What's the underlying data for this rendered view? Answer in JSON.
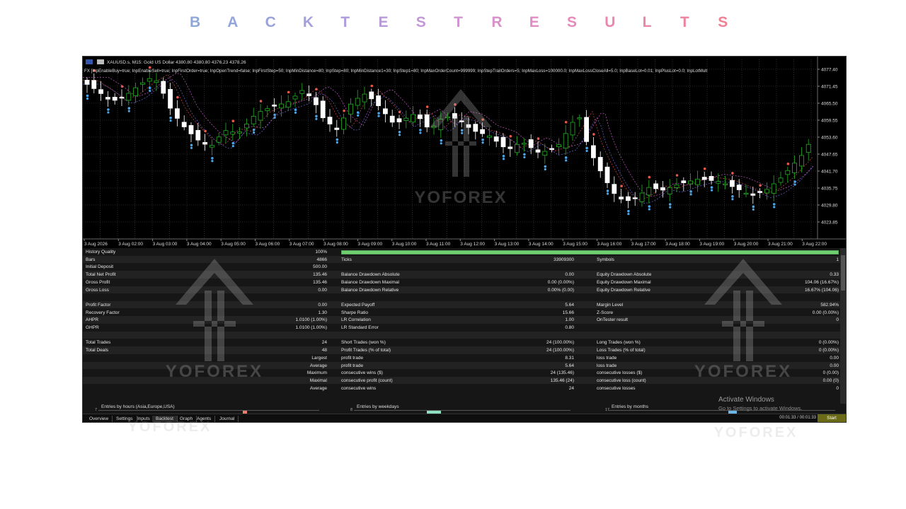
{
  "heading": {
    "letters": [
      "B",
      "A",
      "C",
      "K",
      "T",
      "E",
      "S",
      "T",
      "R",
      "E",
      "S",
      "U",
      "L",
      "T",
      "S"
    ],
    "colors": [
      "#8fa8d8",
      "#93a6da",
      "#9aa2dc",
      "#a39fdc",
      "#ad9cdb",
      "#b89ad9",
      "#c497d6",
      "#cf94d2",
      "#d991cc",
      "#e08dc4",
      "#e68abb",
      "#ea87b1",
      "#ed85a7",
      "#ef839d",
      "#f08194"
    ]
  },
  "chart": {
    "header": {
      "symbol": "XAUUSD.s, M15:  Gold US Dollar  4380.80 4380.80 4376.23 4378.26",
      "params": "FX [InpEnableBuy=true; InpEnableSell=true; InpFirstOrder=true; InpOpenTrend=false; InpFirstStep=50; InpMinDistance=80; InpStep=80; InpMinDistance1=30; InpStep1=80; InpMaxOrderCount=999999; InpStepTrailOrders=5; InpMaxLoss=100000.0; InpMaxLossCloseAll=5.0; InpBaseLot=0.01; InpPlusLot=0.0; InpLotMult"
    },
    "price_labels": [
      "4077.40",
      "4071.45",
      "4065.50",
      "4059.55",
      "4053.60",
      "4047.65",
      "4041.70",
      "4035.75",
      "4029.80",
      "4023.85"
    ],
    "time_labels": [
      "3 Aug 2026",
      "3 Aug 02:00",
      "3 Aug 03:00",
      "3 Aug 04:00",
      "3 Aug 05:00",
      "3 Aug 06:00",
      "3 Aug 07:00",
      "3 Aug 08:00",
      "3 Aug 09:00",
      "3 Aug 10:00",
      "3 Aug 11:00",
      "3 Aug 12:00",
      "3 Aug 13:00",
      "3 Aug 14:00",
      "3 Aug 15:00",
      "3 Aug 16:00",
      "3 Aug 17:00",
      "3 Aug 18:00",
      "3 Aug 19:00",
      "3 Aug 20:00",
      "3 Aug 21:00",
      "3 Aug 22:00"
    ],
    "watermark": "YOFOREX",
    "colors": {
      "bull": "#22b022",
      "bear": "#ffffff",
      "grid": "#4a4a4a",
      "buy_marker": "#4aa6e8",
      "sell_marker": "#e8584a"
    }
  },
  "report": {
    "quality": {
      "label": "History Quality",
      "value": "100%",
      "fraction": 1.0
    },
    "rows": [
      {
        "c1": [
          "Bars",
          "4866"
        ],
        "c2": [
          "Ticks",
          "33909300"
        ],
        "c3": [
          "Symbols",
          "1"
        ]
      },
      {
        "c1": [
          "Initial Deposit",
          "500.00"
        ],
        "c2": [
          "",
          ""
        ],
        "c3": [
          "",
          ""
        ]
      },
      {
        "c1": [
          "Total Net Profit",
          "135.46"
        ],
        "c2": [
          "Balance Drawdown Absolute",
          "0.00"
        ],
        "c3": [
          "Equity Drawdown Absolute",
          "0.33"
        ]
      },
      {
        "c1": [
          "Gross Profit",
          "135.46"
        ],
        "c2": [
          "Balance Drawdown Maximal",
          "0.00 (0.00%)"
        ],
        "c3": [
          "Equity Drawdown Maximal",
          "104.06 (16.67%)"
        ]
      },
      {
        "c1": [
          "Gross Loss",
          "0.00"
        ],
        "c2": [
          "Balance Drawdown Relative",
          "0.00% (0.00)"
        ],
        "c3": [
          "Equity Drawdown Relative",
          "16.67% (104.06)"
        ]
      },
      {
        "c1": [
          "",
          ""
        ],
        "c2": [
          "",
          ""
        ],
        "c3": [
          "",
          ""
        ]
      },
      {
        "c1": [
          "Profit Factor",
          "0.00"
        ],
        "c2": [
          "Expected Payoff",
          "5.64"
        ],
        "c3": [
          "Margin Level",
          "582.94%"
        ]
      },
      {
        "c1": [
          "Recovery Factor",
          "1.30"
        ],
        "c2": [
          "Sharpe Ratio",
          "15.66"
        ],
        "c3": [
          "Z-Score",
          "0.00 (0.00%)"
        ]
      },
      {
        "c1": [
          "AHPR",
          "1.0100 (1.00%)"
        ],
        "c2": [
          "LR Correlation",
          "1.00"
        ],
        "c3": [
          "OnTester result",
          "0"
        ]
      },
      {
        "c1": [
          "GHPR",
          "1.0100 (1.00%)"
        ],
        "c2": [
          "LR Standard Error",
          "0.80"
        ],
        "c3": [
          "",
          ""
        ]
      },
      {
        "c1": [
          "",
          ""
        ],
        "c2": [
          "",
          ""
        ],
        "c3": [
          "",
          ""
        ]
      },
      {
        "c1": [
          "Total Trades",
          "24"
        ],
        "c2": [
          "Short Trades (won %)",
          "24 (100.00%)"
        ],
        "c3": [
          "Long Trades (won %)",
          "0 (0.00%)"
        ]
      },
      {
        "c1": [
          "Total Deals",
          "48"
        ],
        "c2": [
          "Profit Trades (% of total)",
          "24 (100.00%)"
        ],
        "c3": [
          "Loss Trades (% of total)",
          "0 (0.00%)"
        ]
      },
      {
        "c1": [
          "",
          "Largest"
        ],
        "c2": [
          "profit trade",
          "8.31"
        ],
        "c3": [
          "loss trade",
          "0.00"
        ]
      },
      {
        "c1": [
          "",
          "Average"
        ],
        "c2": [
          "profit trade",
          "5.64"
        ],
        "c3": [
          "loss trade",
          "0.00"
        ]
      },
      {
        "c1": [
          "",
          "Maximum"
        ],
        "c2": [
          "consecutive wins ($)",
          "24 (135.46)"
        ],
        "c3": [
          "consecutive losses ($)",
          "0 (0.00)"
        ]
      },
      {
        "c1": [
          "",
          "Maximal"
        ],
        "c2": [
          "consecutive profit (count)",
          "135.46 (24)"
        ],
        "c3": [
          "consecutive loss (count)",
          "0.00 (0)"
        ]
      },
      {
        "c1": [
          "",
          "Average"
        ],
        "c2": [
          "consecutive wins",
          "24"
        ],
        "c3": [
          "consecutive losses",
          "0"
        ]
      }
    ]
  },
  "histograms": [
    {
      "title": "Entries by hours (Asia,Europe,USA)",
      "num": "7",
      "bar_color": "#e8806a"
    },
    {
      "title": "Entries by weekdays",
      "num": "8",
      "bar_color": "#8fe0c0"
    },
    {
      "title": "Entries by months",
      "num": "17",
      "bar_color": "#6ab8e8"
    }
  ],
  "tabs": [
    "Overview",
    "Settings",
    "Inputs",
    "Backtest",
    "Graph",
    "Agents",
    "Journal"
  ],
  "active_tab": "Backtest",
  "timer": "00:01:33 / 00:01:33",
  "start_label": "Start",
  "activate_windows": {
    "title": "Activate Windows",
    "subtitle": "Go to Settings to activate Windows."
  },
  "watermark": "YOFOREX"
}
